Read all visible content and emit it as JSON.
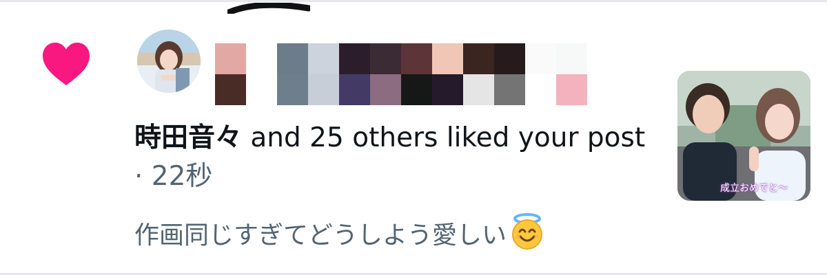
{
  "notification": {
    "icon": "heart-icon",
    "accent_color": "#f91880",
    "actor_name": "時田音々",
    "summary": " and 25 others liked your post",
    "separator": " · ",
    "time": "22秒",
    "post_text": "作画同じすぎてどうしよう愛しい",
    "post_emoji": "smiling-face-with-halo-icon",
    "thumbnail_caption": "成立おめでと〜"
  },
  "colors": {
    "text_primary": "#0f1419",
    "text_secondary": "#536471",
    "divider": "#e6e8eb"
  }
}
